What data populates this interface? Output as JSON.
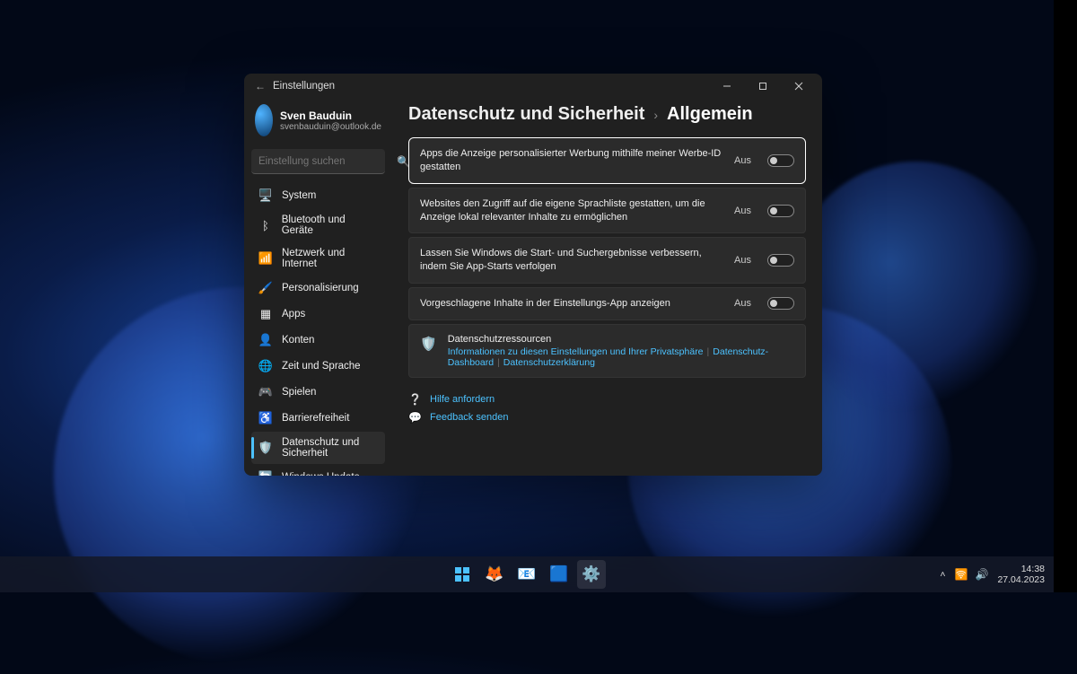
{
  "window": {
    "title": "Einstellungen",
    "minimize": "–",
    "maximize": "□",
    "close": "✕"
  },
  "profile": {
    "name": "Sven Bauduin",
    "email": "svenbauduin@outlook.de"
  },
  "search": {
    "placeholder": "Einstellung suchen"
  },
  "nav": [
    {
      "icon": "🖥️",
      "label": "System"
    },
    {
      "icon": "ᛒ",
      "label": "Bluetooth und Geräte"
    },
    {
      "icon": "📶",
      "label": "Netzwerk und Internet"
    },
    {
      "icon": "🖌️",
      "label": "Personalisierung"
    },
    {
      "icon": "▦",
      "label": "Apps"
    },
    {
      "icon": "👤",
      "label": "Konten"
    },
    {
      "icon": "🌐",
      "label": "Zeit und Sprache"
    },
    {
      "icon": "🎮",
      "label": "Spielen"
    },
    {
      "icon": "♿",
      "label": "Barrierefreiheit"
    },
    {
      "icon": "🛡️",
      "label": "Datenschutz und Sicherheit"
    },
    {
      "icon": "🔄",
      "label": "Windows Update"
    }
  ],
  "nav_active_index": 9,
  "breadcrumb": {
    "parent": "Datenschutz und Sicherheit",
    "sep": "›",
    "current": "Allgemein"
  },
  "settings": [
    {
      "label": "Apps die Anzeige personalisierter Werbung mithilfe meiner Werbe-ID gestatten",
      "state": "Aus",
      "highlight": true
    },
    {
      "label": "Websites den Zugriff auf die eigene Sprachliste gestatten, um die Anzeige lokal relevanter Inhalte zu ermöglichen",
      "state": "Aus",
      "highlight": false
    },
    {
      "label": "Lassen Sie Windows die Start- und Suchergebnisse verbessern, indem Sie App-Starts verfolgen",
      "state": "Aus",
      "highlight": false
    },
    {
      "label": "Vorgeschlagene Inhalte in der Einstellungs-App anzeigen",
      "state": "Aus",
      "highlight": false
    }
  ],
  "resources": {
    "title": "Datenschutzressourcen",
    "links": [
      "Informationen zu diesen Einstellungen und Ihrer Privatsphäre",
      "Datenschutz-Dashboard",
      "Datenschutzerklärung"
    ]
  },
  "footer": {
    "help": "Hilfe anfordern",
    "feedback": "Feedback senden"
  },
  "taskbar": {
    "time": "14:38",
    "date": "27.04.2023"
  }
}
